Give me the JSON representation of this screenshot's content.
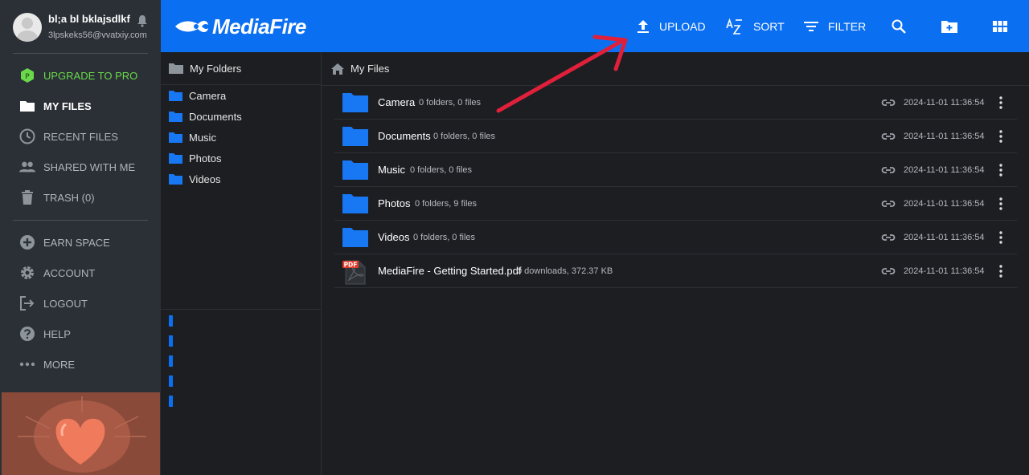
{
  "user": {
    "name": "bl;a bl bklajsdlkf",
    "email": "3lpskeks56@vvatxiy.com"
  },
  "sidebar": {
    "items": [
      {
        "label": "UPGRADE TO PRO",
        "icon": "upgrade-hex-icon",
        "badge": "P"
      },
      {
        "label": "MY FILES",
        "icon": "folder-icon"
      },
      {
        "label": "RECENT FILES",
        "icon": "clock-icon"
      },
      {
        "label": "SHARED WITH ME",
        "icon": "people-icon"
      },
      {
        "label": "TRASH (0)",
        "icon": "trash-icon"
      },
      {
        "label": "EARN SPACE",
        "icon": "plus-circle-icon"
      },
      {
        "label": "ACCOUNT",
        "icon": "gear-icon"
      },
      {
        "label": "LOGOUT",
        "icon": "logout-icon"
      },
      {
        "label": "HELP",
        "icon": "help-icon"
      },
      {
        "label": "MORE",
        "icon": "more-dots-icon"
      }
    ]
  },
  "topbar": {
    "logo": "MediaFire",
    "upload": "UPLOAD",
    "sort": "SORT",
    "filter": "FILTER"
  },
  "tree": {
    "header": "My Folders",
    "items": [
      "Camera",
      "Documents",
      "Music",
      "Photos",
      "Videos"
    ]
  },
  "main": {
    "breadcrumb": "My Files",
    "files": [
      {
        "name": "Camera",
        "meta": "0 folders, 0 files",
        "date": "2024-11-01 11:36:54",
        "type": "folder"
      },
      {
        "name": "Documents",
        "meta": "0 folders, 0 files",
        "date": "2024-11-01 11:36:54",
        "type": "folder"
      },
      {
        "name": "Music",
        "meta": "0 folders, 0 files",
        "date": "2024-11-01 11:36:54",
        "type": "folder"
      },
      {
        "name": "Photos",
        "meta": "0 folders, 9 files",
        "date": "2024-11-01 11:36:54",
        "type": "folder"
      },
      {
        "name": "Videos",
        "meta": "0 folders, 0 files",
        "date": "2024-11-01 11:36:54",
        "type": "folder"
      },
      {
        "name": "MediaFire - Getting Started.pdf",
        "meta": "0 downloads, 372.37 KB",
        "date": "2024-11-01 11:36:54",
        "type": "pdf",
        "badge": "PDF"
      }
    ]
  },
  "colors": {
    "brand": "#0b6ff2",
    "pro_green": "#6ad84b",
    "annotation_arrow": "#e0203a"
  }
}
